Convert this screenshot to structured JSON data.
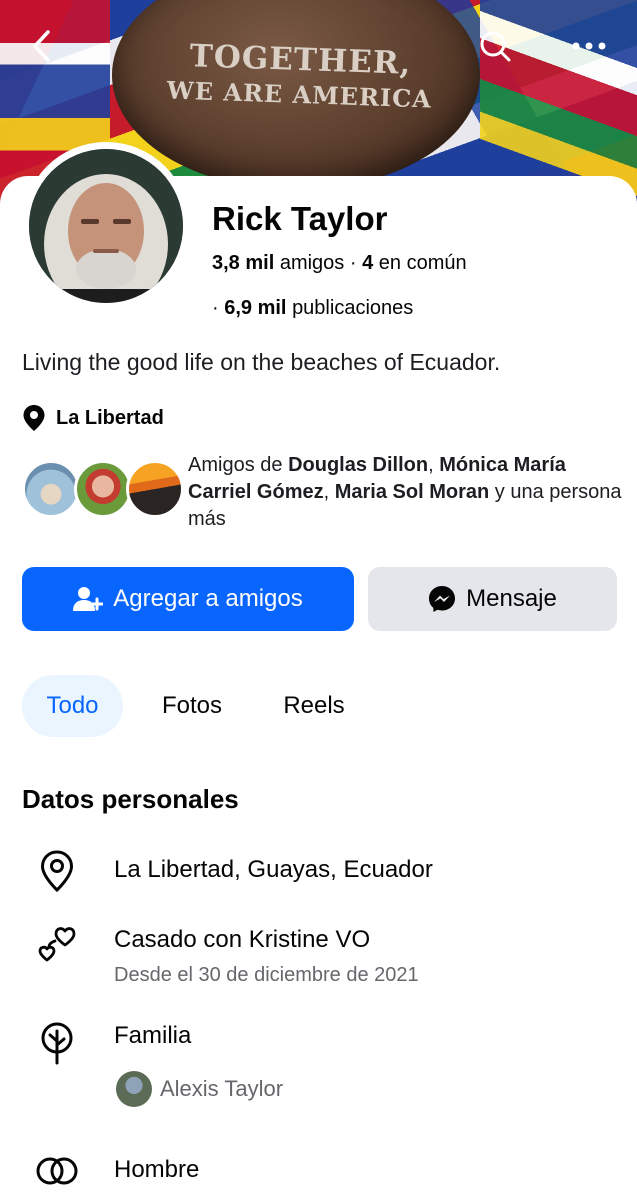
{
  "cover": {
    "ball_line1": "TOGETHER,",
    "ball_line2": "WE ARE AMERICA"
  },
  "header": {
    "back_icon": "chevron-left-icon",
    "search_icon": "search-icon",
    "more_icon": "more-horizontal-icon"
  },
  "profile": {
    "name": "Rick Taylor",
    "friends_count": "3,8 mil",
    "friends_label": "amigos",
    "separator": "·",
    "common_count": "4",
    "common_label": "en común",
    "posts_count": "6,9 mil",
    "posts_label": "publicaciones",
    "bio": "Living the good life on the beaches of Ecuador.",
    "location": "La Libertad"
  },
  "mutual": {
    "prefix": "Amigos de",
    "friend1": "Douglas Dillon",
    "comma": ",",
    "friend2": "Mónica María Carriel Gómez",
    "friend3": "Maria Sol Moran",
    "suffix": "y una persona más"
  },
  "actions": {
    "add_friend": "Agregar a amigos",
    "message": "Mensaje"
  },
  "tabs": [
    {
      "label": "Todo",
      "active": true
    },
    {
      "label": "Fotos",
      "active": false
    },
    {
      "label": "Reels",
      "active": false
    }
  ],
  "details": {
    "title": "Datos personales",
    "hometown": "La Libertad, Guayas, Ecuador",
    "relationship": "Casado con Kristine VO",
    "relationship_since": "Desde el 30 de diciembre de 2021",
    "family_label": "Familia",
    "family_member": "Alexis Taylor",
    "gender": "Hombre"
  },
  "colors": {
    "accent": "#0866ff",
    "secondary_button": "#e4e6eb",
    "muted_text": "#65676b",
    "active_tab_bg": "#ebf5ff"
  }
}
